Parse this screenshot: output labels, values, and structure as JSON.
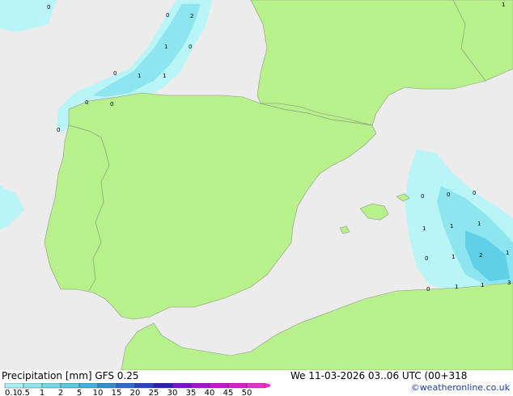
{
  "footer": {
    "title": "Precipitation [mm]  GFS 0.25",
    "run": "We 11-03-2026 03..06 UTC (00+318",
    "credit": "©weatheronline.co.uk"
  },
  "legend": {
    "labels": [
      "0.1",
      "0.5",
      "1",
      "2",
      "5",
      "10",
      "15",
      "20",
      "25",
      "30",
      "35",
      "40",
      "45",
      "50"
    ],
    "colors": [
      "#a6f0f5",
      "#8ee6ef",
      "#72d9e8",
      "#56cbe1",
      "#3fb3d9",
      "#2f8fd0",
      "#2b6ad0",
      "#2a43c9",
      "#2a1fb8",
      "#7d0fd8",
      "#a80fd8",
      "#cc12d6",
      "#e218d0",
      "#f02ccc"
    ]
  },
  "colors": {
    "land": "#b8f08c",
    "sea": "#ececec",
    "precip_light": "#b9f4f6",
    "precip_mid": "#8de5ef",
    "precip_heavy": "#5fd0e6"
  },
  "point_values": [
    "0",
    "2",
    "0",
    "1",
    "0",
    "0",
    "1",
    "1",
    "0",
    "0",
    "0",
    "1",
    "0",
    "0",
    "0",
    "1",
    "1",
    "1",
    "0",
    "2",
    "1",
    "0",
    "1",
    "1",
    "3"
  ]
}
